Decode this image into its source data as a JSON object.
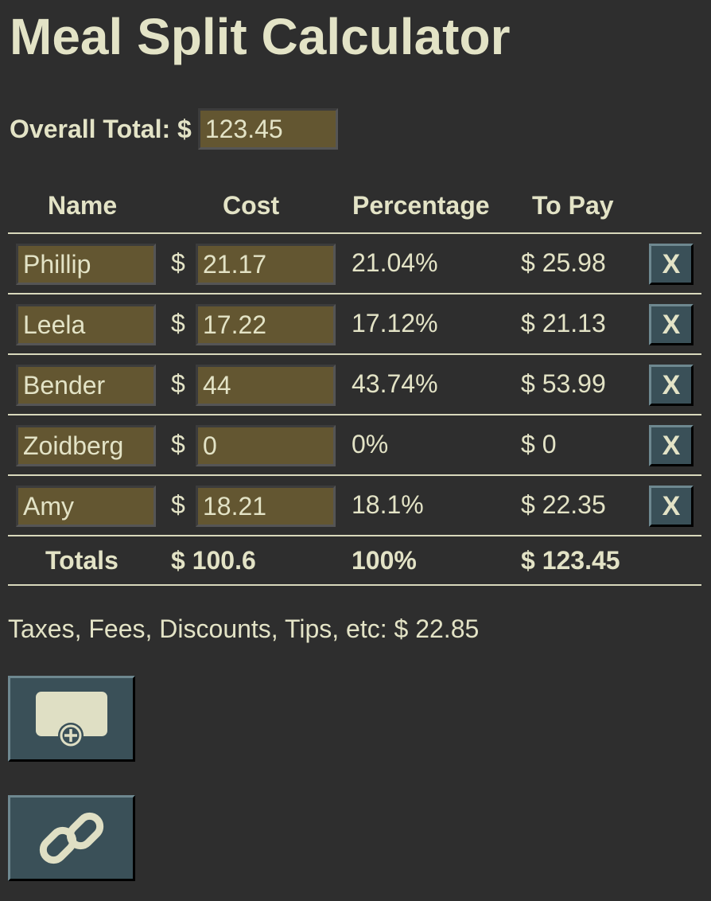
{
  "title": "Meal Split Calculator",
  "overall": {
    "label": "Overall Total: $",
    "value": "123.45"
  },
  "headers": {
    "name": "Name",
    "cost": "Cost",
    "percentage": "Percentage",
    "to_pay": "To Pay"
  },
  "currency": "$",
  "rows": [
    {
      "name": "Phillip",
      "cost": "21.17",
      "percentage": "21.04%",
      "to_pay": "$ 25.98",
      "remove": "X"
    },
    {
      "name": "Leela",
      "cost": "17.22",
      "percentage": "17.12%",
      "to_pay": "$ 21.13",
      "remove": "X"
    },
    {
      "name": "Bender",
      "cost": "44",
      "percentage": "43.74%",
      "to_pay": "$ 53.99",
      "remove": "X"
    },
    {
      "name": "Zoidberg",
      "cost": "0",
      "percentage": "0%",
      "to_pay": "$ 0",
      "remove": "X"
    },
    {
      "name": "Amy",
      "cost": "18.21",
      "percentage": "18.1%",
      "to_pay": "$ 22.35",
      "remove": "X"
    }
  ],
  "totals": {
    "label": "Totals",
    "cost": "$ 100.6",
    "percentage": "100%",
    "to_pay": "$ 123.45"
  },
  "extras": "Taxes, Fees, Discounts, Tips, etc: $ 22.85",
  "buttons": {
    "add_icon": "add-person-icon",
    "link_icon": "link-icon"
  }
}
